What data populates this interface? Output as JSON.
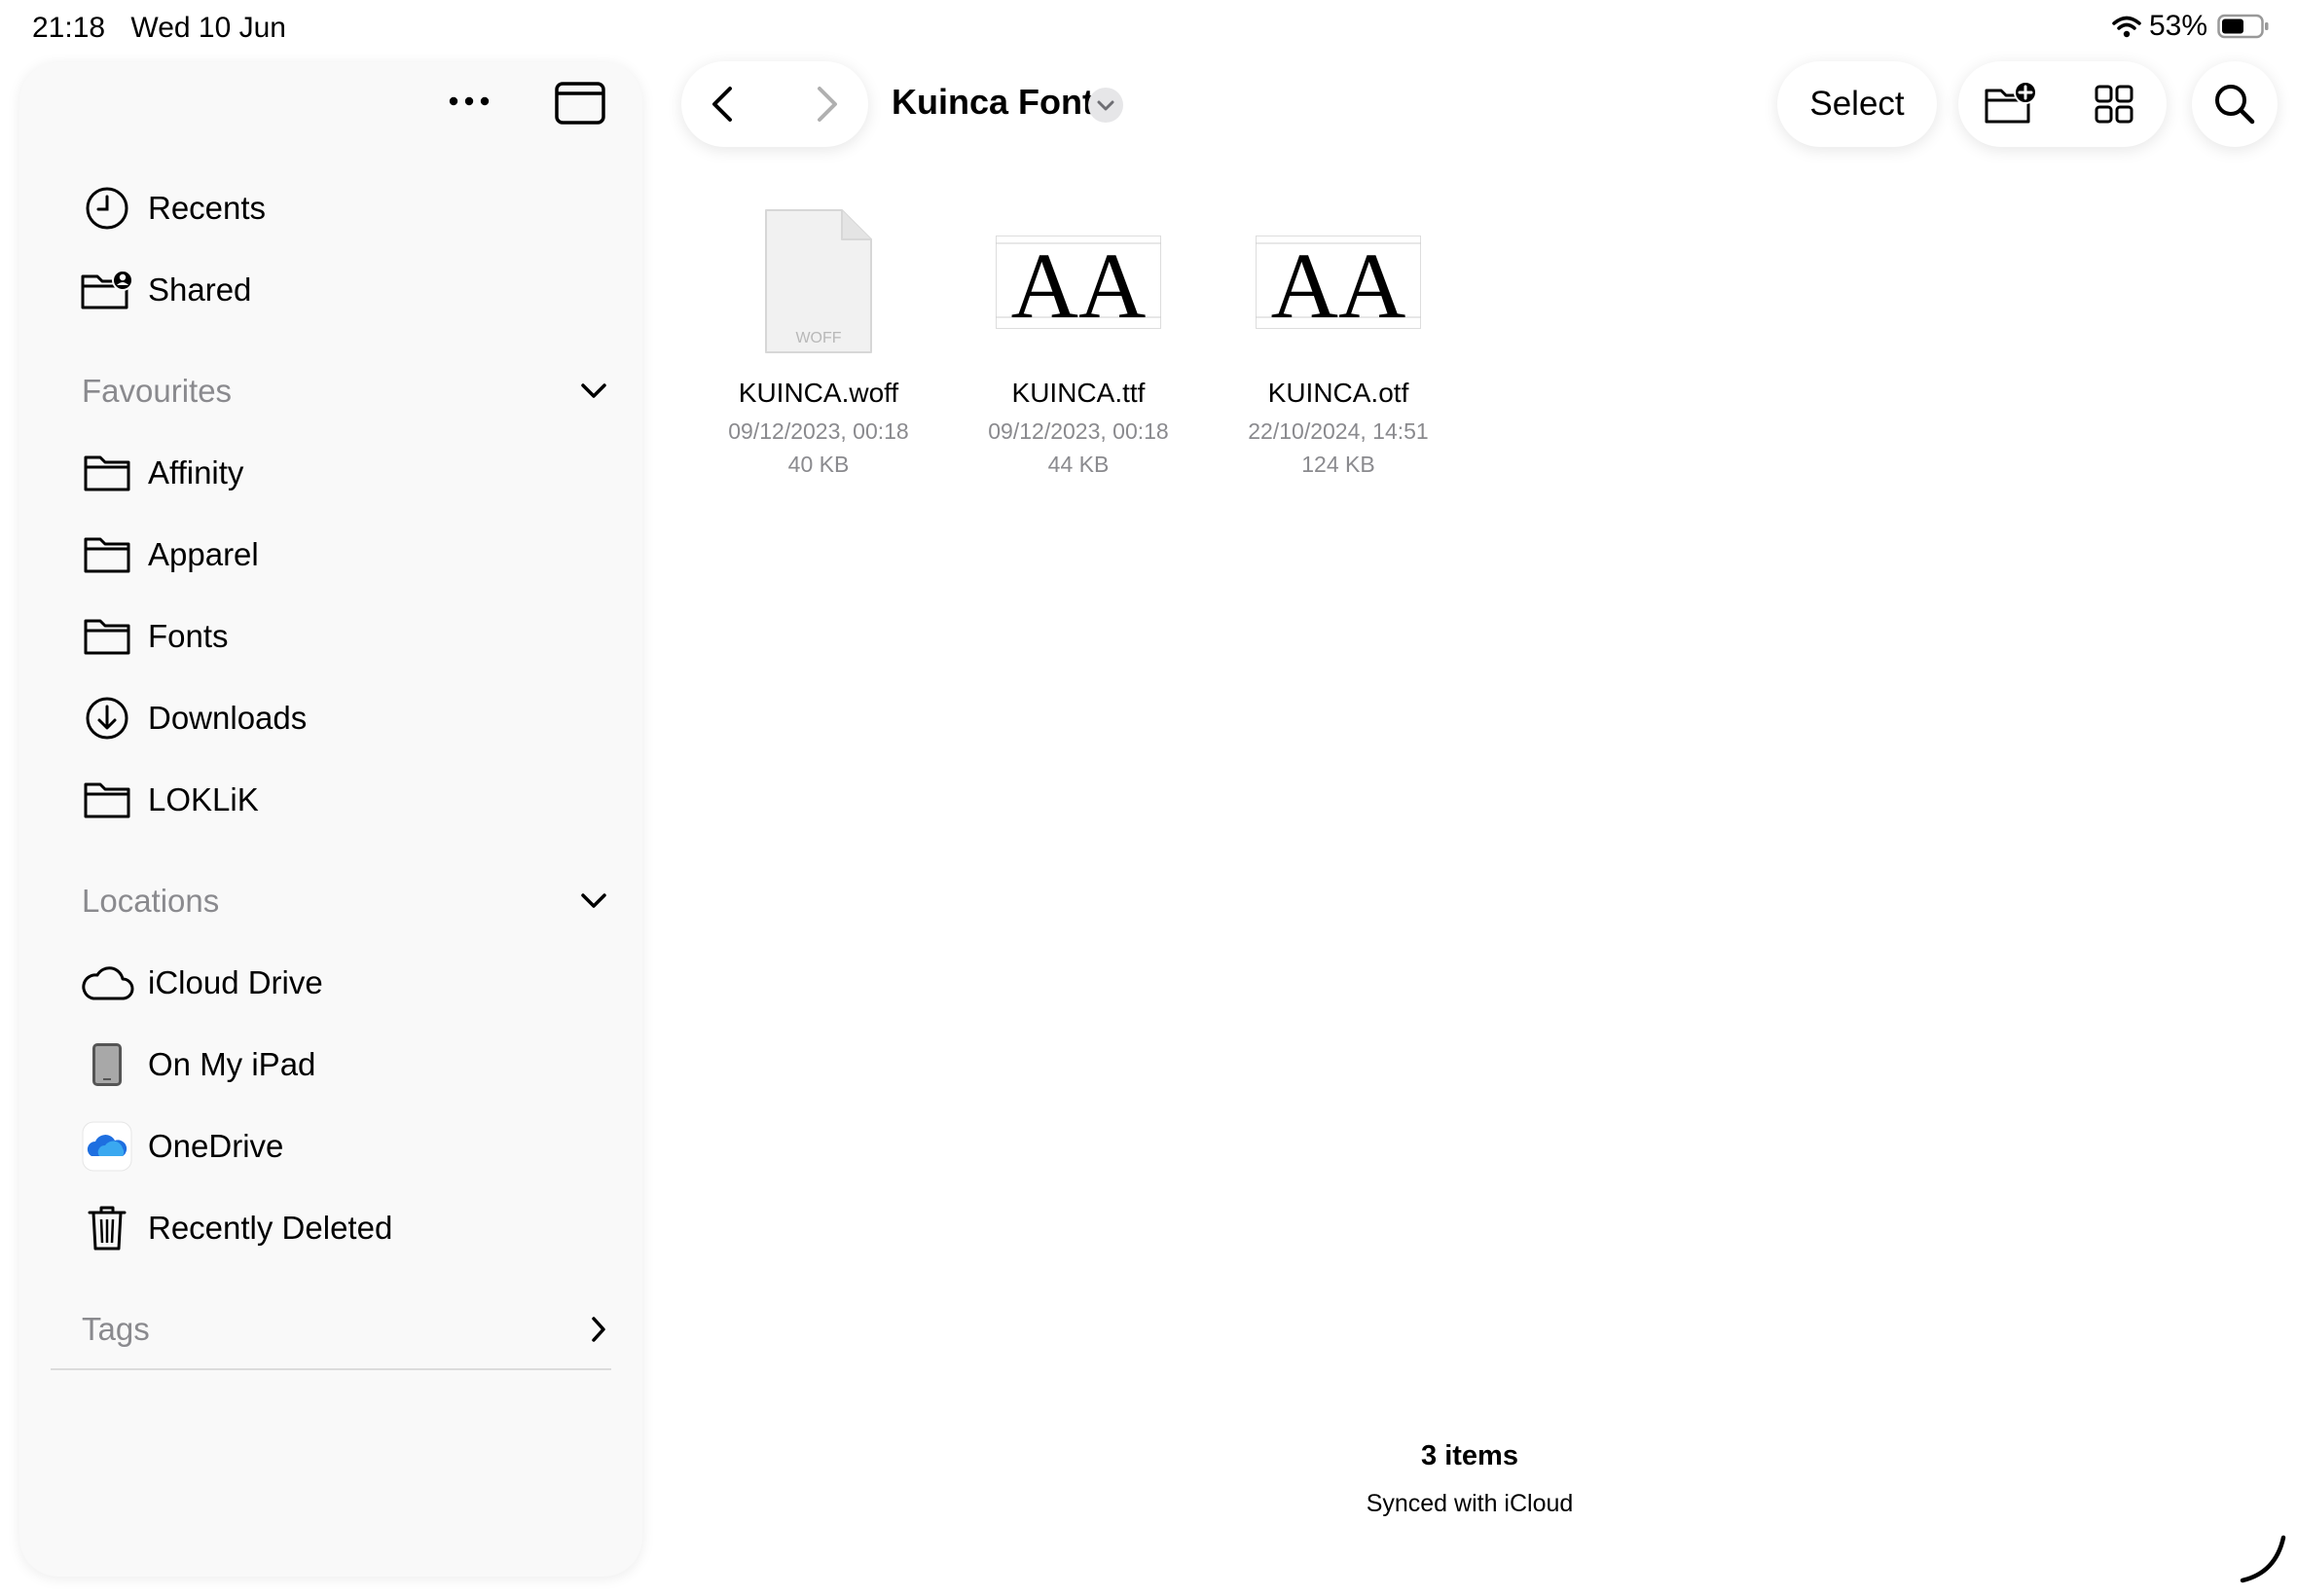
{
  "status": {
    "time": "21:18",
    "date": "Wed 10 Jun",
    "battery": "53%"
  },
  "sidebar": {
    "top": [
      {
        "label": "Recents",
        "icon": "clock-icon"
      },
      {
        "label": "Shared",
        "icon": "shared-folder-icon"
      }
    ],
    "favourites": {
      "title": "Favourites",
      "items": [
        {
          "label": "Affinity",
          "icon": "folder-icon"
        },
        {
          "label": "Apparel",
          "icon": "folder-icon"
        },
        {
          "label": "Fonts",
          "icon": "folder-icon"
        },
        {
          "label": "Downloads",
          "icon": "download-circle-icon"
        },
        {
          "label": "LOKLiK",
          "icon": "folder-icon"
        }
      ]
    },
    "locations": {
      "title": "Locations",
      "items": [
        {
          "label": "iCloud Drive",
          "icon": "cloud-icon"
        },
        {
          "label": "On My iPad",
          "icon": "ipad-icon"
        },
        {
          "label": "OneDrive",
          "icon": "onedrive-icon"
        },
        {
          "label": "Recently Deleted",
          "icon": "trash-icon"
        }
      ]
    },
    "tags": {
      "title": "Tags"
    }
  },
  "toolbar": {
    "folder_title": "Kuinca Font",
    "select_label": "Select"
  },
  "files": [
    {
      "name": "KUINCA.woff",
      "date": "09/12/2023, 00:18",
      "size": "40 KB",
      "thumb_text": "WOFF"
    },
    {
      "name": "KUINCA.ttf",
      "date": "09/12/2023, 00:18",
      "size": "44 KB",
      "thumb_text": "AA"
    },
    {
      "name": "KUINCA.otf",
      "date": "22/10/2024, 14:51",
      "size": "124 KB",
      "thumb_text": "AA"
    }
  ],
  "footer": {
    "count": "3 items",
    "sync": "Synced with iCloud"
  }
}
